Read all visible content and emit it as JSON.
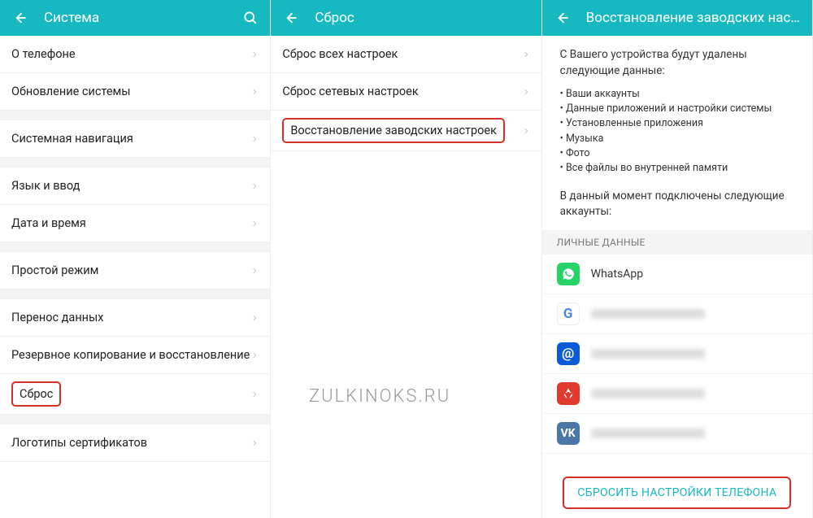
{
  "watermark": "ZULKINOKS.RU",
  "panel1": {
    "title": "Система",
    "items": [
      {
        "label": "О телефоне",
        "group": 0
      },
      {
        "label": "Обновление системы",
        "group": 0
      },
      {
        "label": "Системная навигация",
        "group": 1
      },
      {
        "label": "Язык и ввод",
        "group": 2
      },
      {
        "label": "Дата и время",
        "group": 2
      },
      {
        "label": "Простой режим",
        "group": 3
      },
      {
        "label": "Перенос данных",
        "group": 4
      },
      {
        "label": "Резервное копирование и восстановление",
        "group": 4
      },
      {
        "label": "Сброс",
        "group": 4,
        "highlight": true
      },
      {
        "label": "Логотипы сертификатов",
        "group": 5
      }
    ]
  },
  "panel2": {
    "title": "Сброс",
    "items": [
      {
        "label": "Сброс всех настроек"
      },
      {
        "label": "Сброс сетевых настроек"
      },
      {
        "label": "Восстановление заводских настроек",
        "highlight": true
      }
    ]
  },
  "panel3": {
    "title": "Восстановление заводских настроек",
    "intro": "С Вашего устройства будут удалены следующие данные:",
    "bullets": [
      "Ваши аккаунты",
      "Данные приложений и настройки системы",
      "Установленные приложения",
      "Музыка",
      "Фото",
      "Все файлы во внутренней памяти"
    ],
    "accounts_note": "В данный момент подключены следующие аккаунты:",
    "section_title": "ЛИЧНЫЕ ДАННЫЕ",
    "accounts": [
      {
        "name": "WhatsApp",
        "icon": "whatsapp"
      },
      {
        "name": "",
        "icon": "google",
        "blurred": true
      },
      {
        "name": "",
        "icon": "mail",
        "blurred": true
      },
      {
        "name": "",
        "icon": "huawei",
        "blurred": true
      },
      {
        "name": "",
        "icon": "vk",
        "blurred": true
      }
    ],
    "reset_button": "СБРОСИТЬ НАСТРОЙКИ ТЕЛЕФОНА"
  }
}
